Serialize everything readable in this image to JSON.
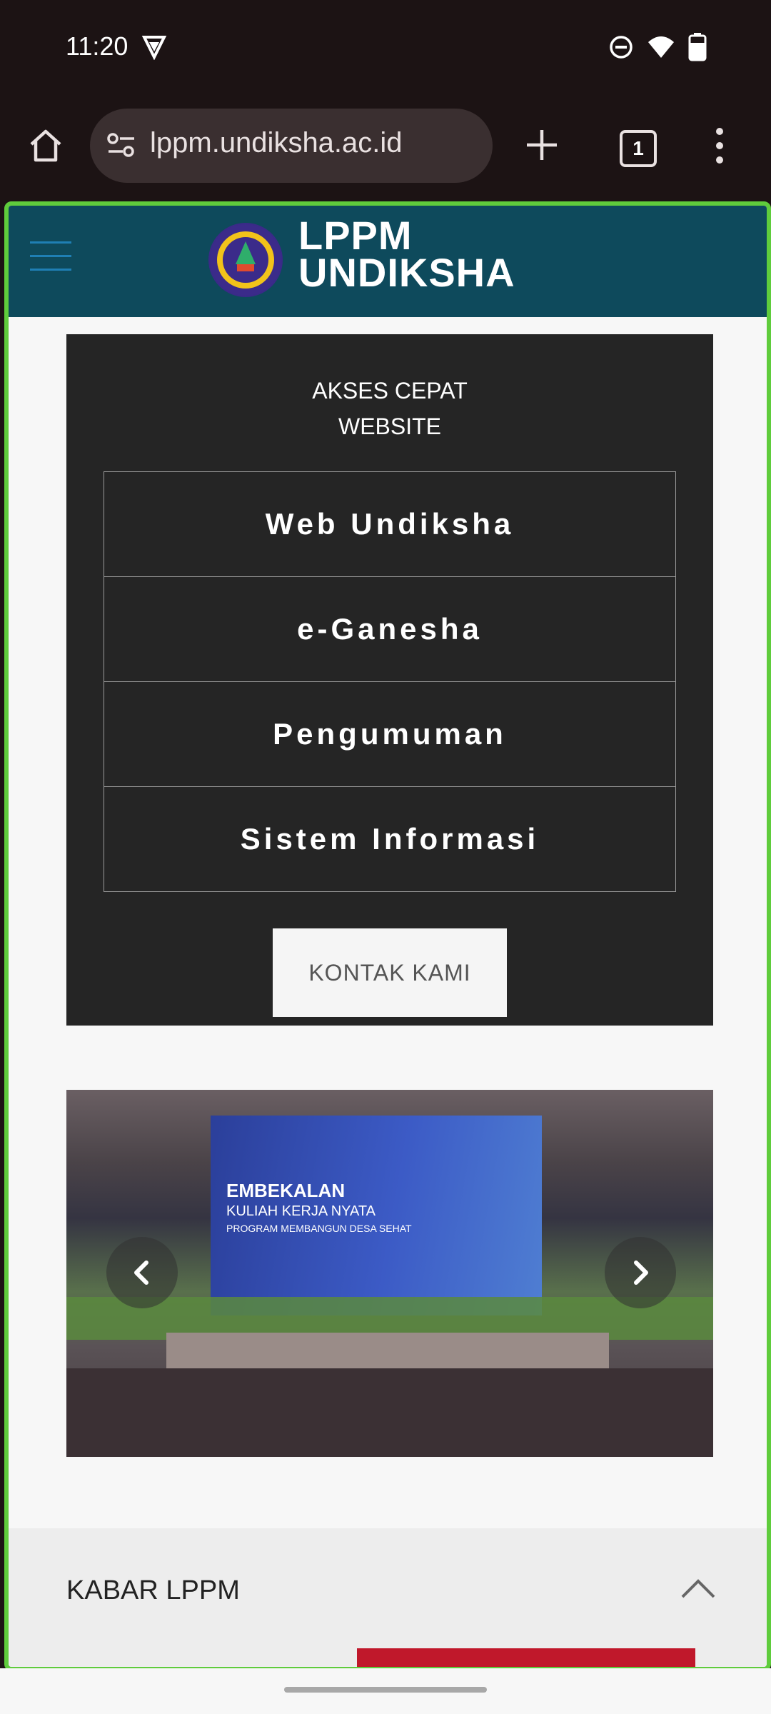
{
  "status_bar": {
    "time": "11:20"
  },
  "browser": {
    "url": "lppm.undiksha.ac.id",
    "tab_count": "1"
  },
  "site": {
    "logo_line1": "LPPM",
    "logo_line2": "UNDIKSHA"
  },
  "quick_access": {
    "title_line1": "AKSES CEPAT",
    "title_line2": "WEBSITE",
    "items": [
      {
        "label": "Web Undiksha"
      },
      {
        "label": "e-Ganesha"
      },
      {
        "label": "Pengumuman"
      },
      {
        "label": "Sistem Informasi"
      }
    ],
    "contact_label": "KONTAK KAMI"
  },
  "carousel": {
    "slide_line1": "EMBEKALAN",
    "slide_line2": "KULIAH KERJA NYATA",
    "slide_line3": "PROGRAM MEMBANGUN DESA SEHAT"
  },
  "news": {
    "title": "KABAR LPPM"
  },
  "colors": {
    "header_bg": "#0e4a5c",
    "quick_box_bg": "#252525",
    "frame_border": "#5fcc3c",
    "news_strip": "#c0182b"
  }
}
